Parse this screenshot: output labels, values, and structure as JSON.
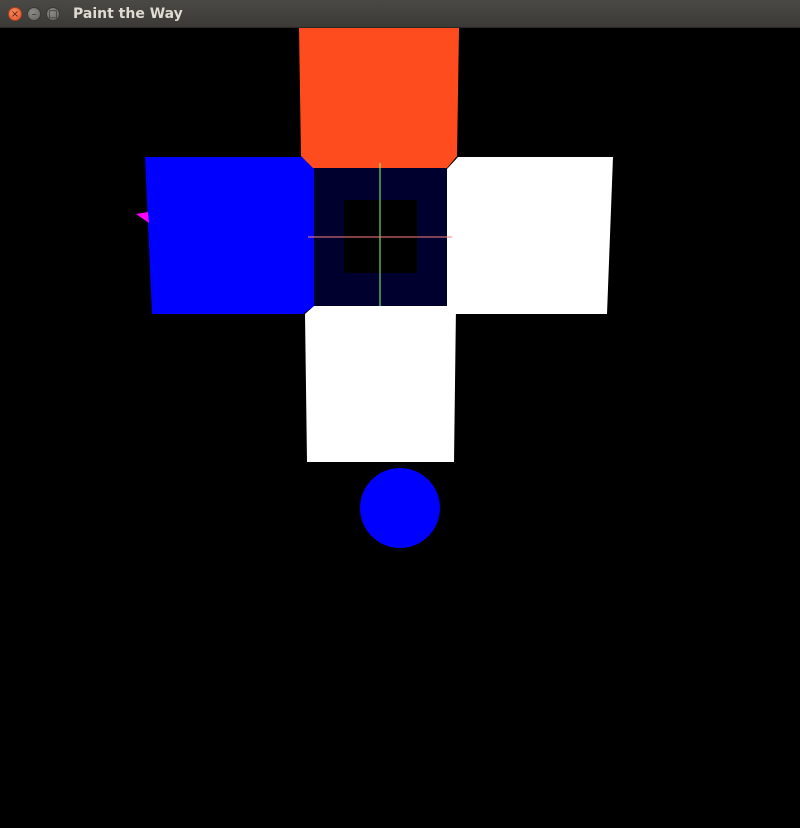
{
  "window": {
    "title": "Paint the Way",
    "close_glyph": "×",
    "minimize_glyph": "–",
    "maximize_glyph": "□"
  },
  "scene": {
    "background_color": "#000000",
    "tile_colors": {
      "top": "#ff4c1f",
      "left": "#0000ff",
      "right": "#ffffff",
      "bottom": "#ffffff",
      "center": "#00002e",
      "center_hole": "#000000"
    },
    "player_color": "#0000ff",
    "marker_color": "#ff00ff",
    "axis_colors": {
      "vertical": "#7fff7f",
      "horizontal": "#ff7f7f"
    }
  }
}
